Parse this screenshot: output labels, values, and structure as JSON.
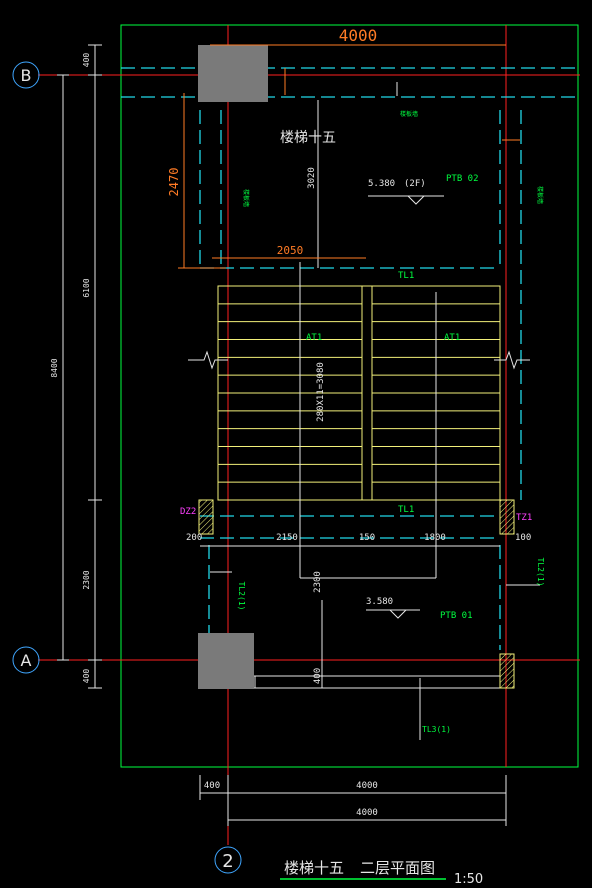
{
  "title": {
    "main": "楼梯十五",
    "sub": "二层平面图",
    "scale": "1:50"
  },
  "room_label": "楼梯十五",
  "axes": {
    "b": "B",
    "a": "A",
    "col": "2"
  },
  "dims": {
    "top_width": "4000",
    "left_400_top": "400",
    "left_6100": "6100",
    "left_8400": "8400",
    "left_2300": "2300",
    "left_400_bot": "400",
    "left_2470": "2470",
    "mid_3020": "3020",
    "landing_2050": "2050",
    "stair_run": "280X11=3080",
    "row_200": "200",
    "row_2150": "2150",
    "row_150": "150",
    "row_1800": "1800",
    "row_100": "100",
    "mid_2300": "2300",
    "mid_400": "400",
    "bot_400": "400",
    "bot_4000a": "4000",
    "bot_4000b": "4000"
  },
  "labels": {
    "tl1_top": "TL1",
    "tl1_bot": "TL1",
    "at1_left": "AT1",
    "at1_right": "AT1",
    "ptb02": "PTB 02",
    "ptb01": "PTB 01",
    "level_upper": "5.380",
    "level_upper_tag": "(2F)",
    "level_lower": "3.580",
    "dz2": "DZ2",
    "tz1": "TZ1",
    "tl2_left": "TL2(1)",
    "tl2_right": "TL2(1)",
    "tl3": "TL3(1)",
    "note_wall_top": "楼板墙",
    "note_wall_left": "楼板墙",
    "note_wall_right": "楼板墙"
  },
  "colors": {
    "grid": "#ff2020",
    "wall": "#21d8e8",
    "stair": "#f2f07a",
    "dim": "#e6e6e6",
    "outline": "#00ff40",
    "label": "#00ff40",
    "orange": "#ff7b25",
    "magenta": "#ff40ff",
    "axis_circle": "#3fa6ff",
    "column": "#7a7a7a"
  }
}
